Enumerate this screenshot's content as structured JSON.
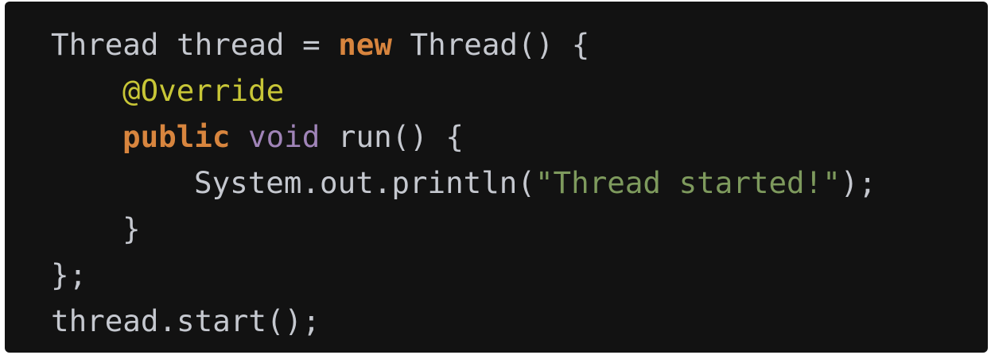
{
  "colors": {
    "background": "#121212",
    "text": "#c5c8cf",
    "keyword_bold": "#d8853e",
    "annotation": "#c8c637",
    "keyword": "#a084b8",
    "string": "#7e9a5d"
  },
  "code": {
    "line1": {
      "a": "Thread thread = ",
      "b": "new",
      "c": " Thread() {"
    },
    "line2": {
      "a": "@Override"
    },
    "line3": {
      "a": "public",
      "b": " ",
      "c": "void",
      "d": " run() {"
    },
    "line4": {
      "a": "System.out.println(",
      "b": "\"Thread started!\"",
      "c": ");"
    },
    "line5": {
      "a": "}"
    },
    "line6": {
      "a": "};"
    },
    "line7": {
      "a": "thread.start();"
    }
  }
}
